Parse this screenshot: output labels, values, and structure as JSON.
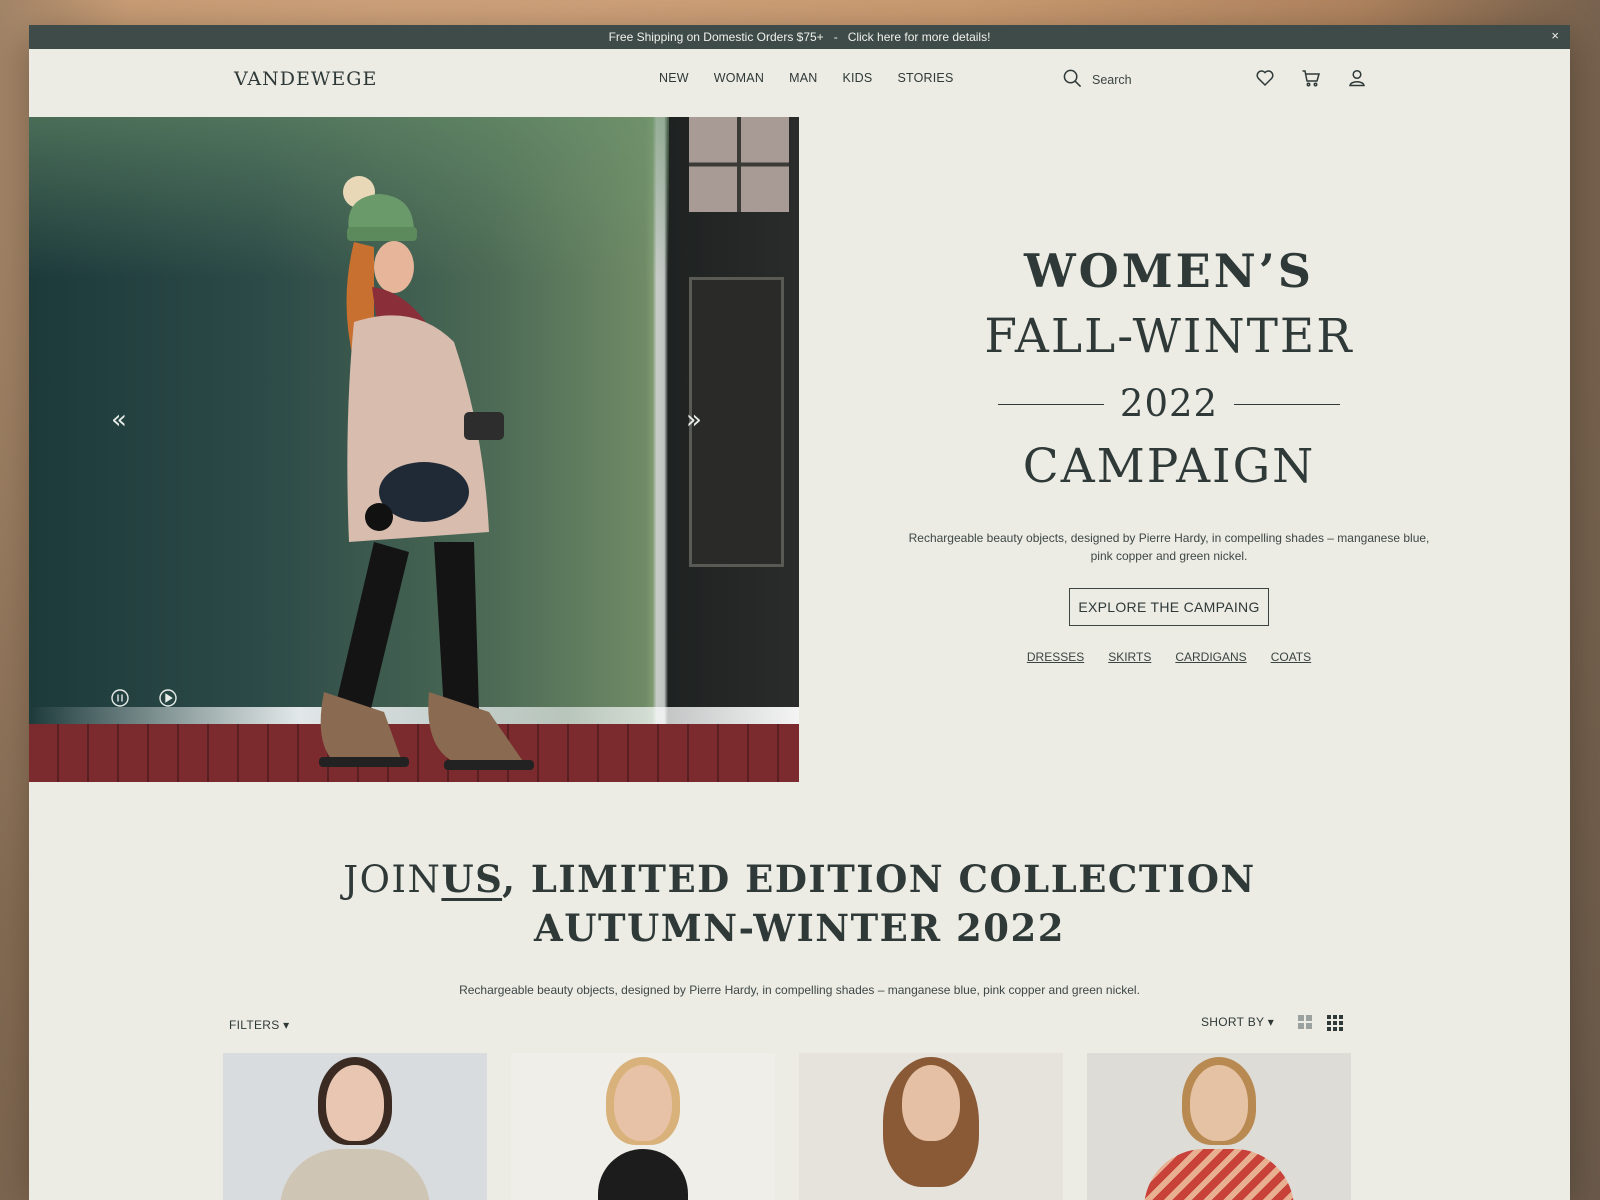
{
  "promo": {
    "shipping_text": "Free Shipping on Domestic Orders $75+",
    "separator": "-",
    "details_link": "Click here for more details!",
    "close_label": "×"
  },
  "header": {
    "logo": "VANDEWEGE",
    "nav": [
      "NEW",
      "WOMAN",
      "MAN",
      "KIDS",
      "STORIES"
    ],
    "search_label": "Search",
    "icons": [
      "heart-icon",
      "cart-icon",
      "user-icon"
    ]
  },
  "hero": {
    "prev_arrow": "«",
    "next_arrow": "»",
    "title_line1": "WOMEN’S",
    "title_line2": "FALL-WINTER",
    "year": "2022",
    "title_line4": "CAMPAIGN",
    "description": "Rechargeable beauty objects, designed by Pierre Hardy, in compelling shades – manganese blue, pink copper and green nickel.",
    "cta": "EXPLORE THE CAMPAING",
    "categories": [
      "DRESSES",
      "SKIRTS",
      "CARDIGANS",
      "COATS"
    ]
  },
  "collection": {
    "heading_part1": "JOIN",
    "heading_us": "US",
    "heading_part2": ", LIMITED EDITION COLLECTION",
    "heading_line2": "AUTUMN-WINTER 2022",
    "description": "Rechargeable beauty objects, designed by Pierre Hardy, in compelling shades – manganese blue, pink copper and green nickel.",
    "filters_label": "FILTERS ▾",
    "sort_label": "SHORT BY ▾"
  },
  "colors": {
    "promo_bg": "#3e4b48",
    "page_bg": "#ecebe4",
    "text_dark": "#2f3a38"
  }
}
